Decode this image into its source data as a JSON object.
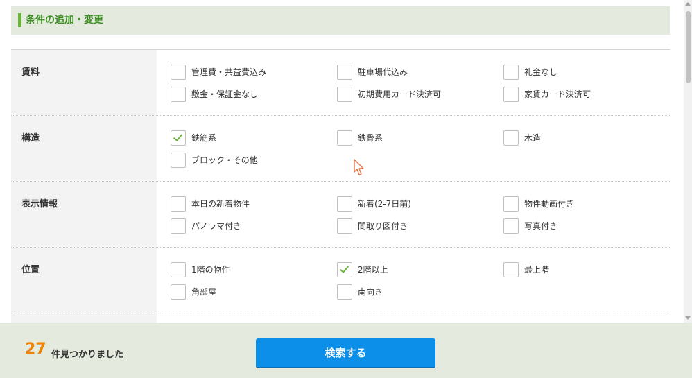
{
  "section": {
    "title": "条件の追加・変更"
  },
  "rows": [
    {
      "label": "賃料",
      "options": [
        {
          "label": "管理費・共益費込み",
          "checked": false
        },
        {
          "label": "駐車場代込み",
          "checked": false
        },
        {
          "label": "礼金なし",
          "checked": false
        },
        {
          "label": "敷金・保証金なし",
          "checked": false
        },
        {
          "label": "初期費用カード決済可",
          "checked": false
        },
        {
          "label": "家賃カード決済可",
          "checked": false
        }
      ]
    },
    {
      "label": "構造",
      "options": [
        {
          "label": "鉄筋系",
          "checked": true
        },
        {
          "label": "鉄骨系",
          "checked": false
        },
        {
          "label": "木造",
          "checked": false
        },
        {
          "label": "ブロック・その他",
          "checked": false
        }
      ]
    },
    {
      "label": "表示情報",
      "options": [
        {
          "label": "本日の新着物件",
          "checked": false
        },
        {
          "label": "新着(2-7日前)",
          "checked": false
        },
        {
          "label": "物件動画付き",
          "checked": false
        },
        {
          "label": "パノラマ付き",
          "checked": false
        },
        {
          "label": "間取り図付き",
          "checked": false
        },
        {
          "label": "写真付き",
          "checked": false
        }
      ]
    },
    {
      "label": "位置",
      "options": [
        {
          "label": "1階の物件",
          "checked": false
        },
        {
          "label": "2階以上",
          "checked": true
        },
        {
          "label": "最上階",
          "checked": false
        },
        {
          "label": "角部屋",
          "checked": false
        },
        {
          "label": "南向き",
          "checked": false
        }
      ]
    }
  ],
  "footer": {
    "count": "27",
    "count_text": "件見つかりました",
    "search_label": "検索する"
  },
  "colors": {
    "accent_green": "#6ab43e",
    "count_orange": "#f08300",
    "button_blue": "#0c8fe8"
  }
}
